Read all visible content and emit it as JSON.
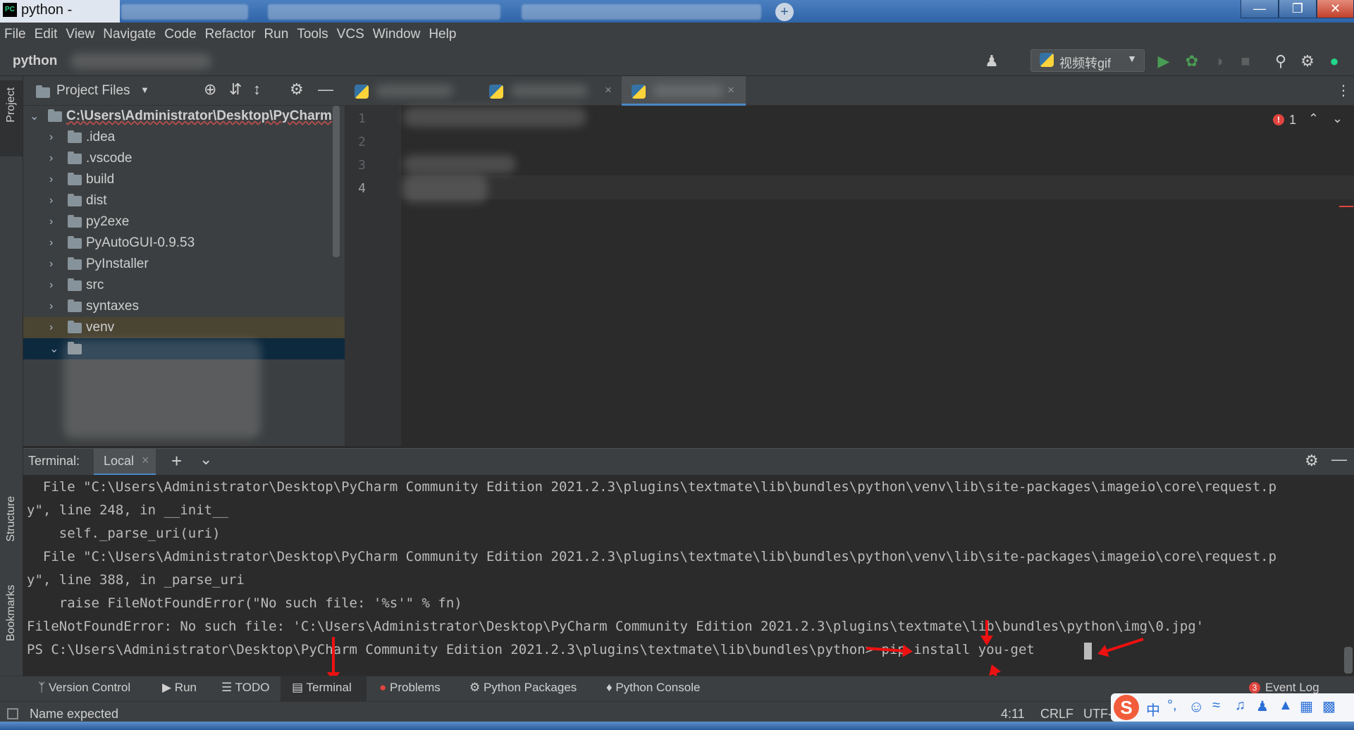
{
  "titlebar": {
    "title": "python -"
  },
  "menu": [
    "File",
    "Edit",
    "View",
    "Navigate",
    "Code",
    "Refactor",
    "Run",
    "Tools",
    "VCS",
    "Window",
    "Help"
  ],
  "nav": {
    "project": "python",
    "run_config": "视频转gif"
  },
  "project_panel": {
    "header": "Project Files",
    "root": "C:\\Users\\Administrator\\Desktop\\PyCharm",
    "folders": [
      ".idea",
      ".vscode",
      "build",
      "dist",
      "py2exe",
      "PyAutoGUI-0.9.53",
      "PyInstaller",
      "src",
      "syntaxes",
      "venv"
    ]
  },
  "side_labels": {
    "project": "Project",
    "structure": "Structure",
    "bookmarks": "Bookmarks"
  },
  "editor": {
    "line_numbers": [
      "1",
      "2",
      "3",
      "4"
    ],
    "error_count": "1"
  },
  "terminal": {
    "title": "Terminal:",
    "tab": "Local",
    "lines": [
      "  File \"C:\\Users\\Administrator\\Desktop\\PyCharm Community Edition 2021.2.3\\plugins\\textmate\\lib\\bundles\\python\\venv\\lib\\site-packages\\imageio\\core\\request.p",
      "y\", line 248, in __init__",
      "    self._parse_uri(uri)",
      "  File \"C:\\Users\\Administrator\\Desktop\\PyCharm Community Edition 2021.2.3\\plugins\\textmate\\lib\\bundles\\python\\venv\\lib\\site-packages\\imageio\\core\\request.p",
      "y\", line 388, in _parse_uri",
      "    raise FileNotFoundError(\"No such file: '%s'\" % fn)",
      "FileNotFoundError: No such file: 'C:\\Users\\Administrator\\Desktop\\PyCharm Community Edition 2021.2.3\\plugins\\textmate\\lib\\bundles\\python\\img\\0.jpg'",
      "PS C:\\Users\\Administrator\\Desktop\\PyCharm Community Edition 2021.2.3\\plugins\\textmate\\lib\\bundles\\python> pip install you-get"
    ]
  },
  "bottom_tools": {
    "version_control": "Version Control",
    "run": "Run",
    "todo": "TODO",
    "terminal": "Terminal",
    "problems": "Problems",
    "python_packages": "Python Packages",
    "python_console": "Python Console",
    "event_log": "Event Log",
    "event_count": "3"
  },
  "status": {
    "message": "Name expected",
    "position": "4:11",
    "line_sep": "CRLF",
    "encoding": "UTF-"
  },
  "ime": {
    "lang": "中"
  },
  "colors": {
    "accent": "#3592c4",
    "error": "#e0443e",
    "annotation": "#ee1111"
  }
}
